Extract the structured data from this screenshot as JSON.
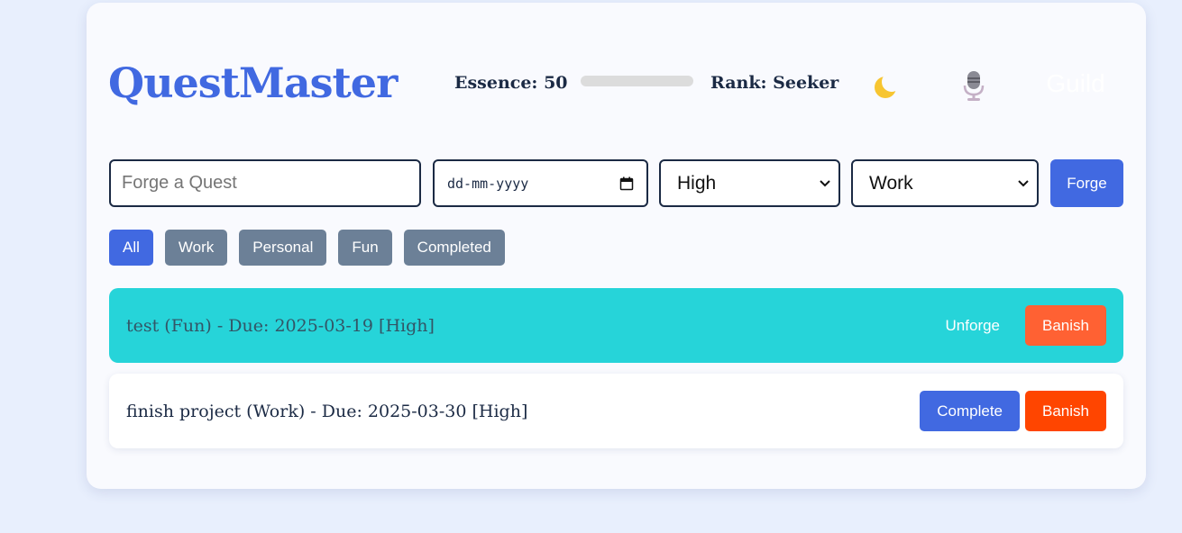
{
  "header": {
    "title": "QuestMaster",
    "essence_label": "Essence: 50",
    "essence_progress": 0.0,
    "rank_label": "Rank: Seeker",
    "theme_icon": "crescent-moon-icon",
    "voice_icon": "microphone-icon",
    "guild_label": "Guild"
  },
  "form": {
    "quest_placeholder": "Forge a Quest",
    "quest_value": "",
    "date_placeholder": "dd-mm-yyyy",
    "priority_selected": "High",
    "category_selected": "Work",
    "forge_label": "Forge"
  },
  "filters": [
    {
      "label": "All",
      "active": true
    },
    {
      "label": "Work",
      "active": false
    },
    {
      "label": "Personal",
      "active": false
    },
    {
      "label": "Fun",
      "active": false
    },
    {
      "label": "Completed",
      "active": false
    }
  ],
  "quests": [
    {
      "text": "test (Fun) - Due: 2025-03-19 [High]",
      "completed": true,
      "toggle_label": "Unforge",
      "delete_label": "Banish"
    },
    {
      "text": "finish project (Work) - Due: 2025-03-30 [High]",
      "completed": false,
      "toggle_label": "Complete",
      "delete_label": "Banish"
    }
  ],
  "colors": {
    "accent": "#4169e1",
    "completed_row": "#26d4d9",
    "banish": "#ff4500",
    "filter_inactive": "#6c8097",
    "background": "#e8effd"
  }
}
